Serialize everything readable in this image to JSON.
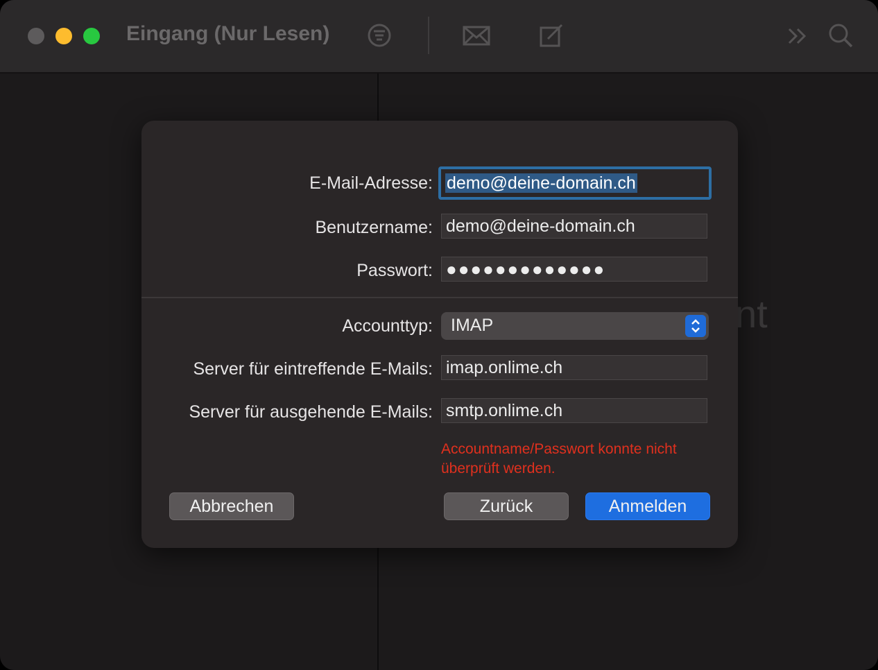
{
  "window": {
    "title": "Eingang (Nur Lesen)",
    "background_hint": "nt"
  },
  "toolbar": {
    "icons": [
      "filter-icon",
      "envelope-icon",
      "compose-icon",
      "more-chevrons-icon",
      "search-icon"
    ]
  },
  "sheet": {
    "email": {
      "label": "E-Mail-Adresse:",
      "value": "demo@deine-domain.ch"
    },
    "username": {
      "label": "Benutzername:",
      "value": "demo@deine-domain.ch"
    },
    "password": {
      "label": "Passwort:",
      "value": "●●●●●●●●●●●●●"
    },
    "account_type": {
      "label": "Accounttyp:",
      "value": "IMAP"
    },
    "incoming_server": {
      "label": "Server für eintreffende E-Mails:",
      "value": "imap.onlime.ch"
    },
    "outgoing_server": {
      "label": "Server für ausgehende E-Mails:",
      "value": "smtp.onlime.ch"
    },
    "error": "Accountname/Passwort konnte nicht überprüft werden.",
    "buttons": {
      "cancel": "Abbrechen",
      "back": "Zurück",
      "sign_in": "Anmelden"
    }
  },
  "colors": {
    "accent": "#1e6ee0",
    "error": "#e0301e",
    "focus_ring": "#2d6ea4"
  }
}
